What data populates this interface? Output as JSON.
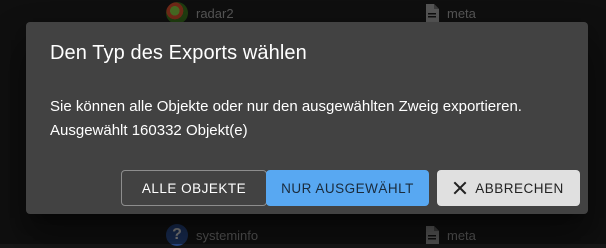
{
  "background": {
    "top_row": {
      "left_label": "radar2",
      "left_icon": "radar-icon",
      "right_label": "meta",
      "right_icon": "document-icon"
    },
    "bottom_row": {
      "left_label": "systeminfo",
      "left_icon": "help-icon",
      "left_icon_glyph": "?",
      "right_label": "meta",
      "right_icon": "document-icon"
    }
  },
  "dialog": {
    "title": "Den Typ des Exports wählen",
    "text_line1": "Sie können alle Objekte oder nur den ausgewählten Zweig exportieren.",
    "text_line2": "Ausgewählt 160332 Objekt(e)",
    "buttons": {
      "all_label": "ALLE OBJEKTE",
      "selected_label": "NUR AUSGEWÄHLT",
      "cancel_label": "ABBRECHEN",
      "cancel_icon": "close-icon"
    }
  },
  "colors": {
    "dialog_bg": "#424242",
    "primary": "#58a8f2",
    "cancel_bg": "#e0e0e0"
  }
}
